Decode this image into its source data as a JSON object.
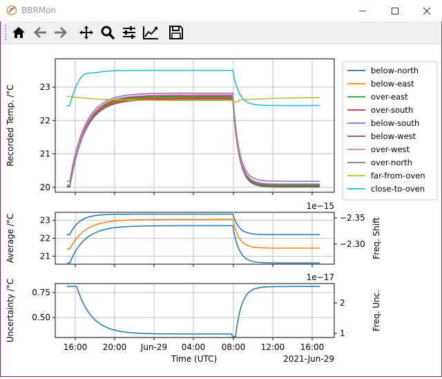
{
  "window": {
    "title": "BBRMon"
  },
  "toolbar": {
    "buttons": [
      "home-icon",
      "back-arrow-icon",
      "forward-arrow-icon",
      "pan-icon",
      "zoom-icon",
      "subplots-config-icon",
      "edit-axes-icon",
      "save-icon"
    ]
  },
  "colors": {
    "below-north": "#1f77b4",
    "below-east": "#ff7f0e",
    "over-east": "#2ca02c",
    "over-south": "#d62728",
    "below-south": "#9467bd",
    "below-west": "#8c564b",
    "over-west": "#e377c2",
    "over-north": "#7f7f7f",
    "far-from-oven": "#bcbd22",
    "close-to-oven": "#17becf"
  },
  "chart_data": [
    {
      "type": "line",
      "ylabel": "Recorded Temp. /°C",
      "ylim": [
        19.85,
        23.85
      ],
      "yticks": [
        "20",
        "21",
        "22",
        "23"
      ],
      "grid": true,
      "legend_position": "right",
      "legend": [
        "below-north",
        "below-east",
        "over-east",
        "over-south",
        "below-south",
        "below-west",
        "over-west",
        "over-north",
        "far-from-oven",
        "close-to-oven"
      ],
      "series": [
        {
          "name": "below-north",
          "profile": "low",
          "baseline": 20.05,
          "plateau": 22.7,
          "tail": 20.08
        },
        {
          "name": "below-east",
          "profile": "low",
          "baseline": 20.03,
          "plateau": 22.68,
          "tail": 20.05
        },
        {
          "name": "over-east",
          "profile": "low",
          "baseline": 20.04,
          "plateau": 22.72,
          "tail": 20.06
        },
        {
          "name": "over-south",
          "profile": "low",
          "baseline": 20.0,
          "plateau": 22.66,
          "tail": 20.02
        },
        {
          "name": "below-south",
          "profile": "low",
          "baseline": 20.18,
          "plateau": 22.82,
          "tail": 20.18
        },
        {
          "name": "below-west",
          "profile": "low",
          "baseline": 20.02,
          "plateau": 22.75,
          "tail": 20.03
        },
        {
          "name": "over-west",
          "profile": "low",
          "baseline": 20.07,
          "plateau": 22.77,
          "tail": 20.1
        },
        {
          "name": "over-north",
          "profile": "low",
          "baseline": 20.0,
          "plateau": 22.63,
          "tail": 20.0
        },
        {
          "name": "far-from-oven",
          "profile": "far",
          "baseline": 22.72,
          "plateau": 22.6,
          "tail": 22.7
        },
        {
          "name": "close-to-oven",
          "profile": "close",
          "baseline": 22.45,
          "plateau": 23.5,
          "tail": 22.45
        }
      ]
    },
    {
      "type": "line",
      "ylabel": "Average /°C",
      "ylim": [
        20.55,
        23.45
      ],
      "yticks": [
        "21",
        "22",
        "23"
      ],
      "right_ylabel": "Freq. Shift",
      "right_ticks": [
        "−2.35",
        "−2.30"
      ],
      "right_exponent": "1e−15",
      "grid": true,
      "series": [
        {
          "name": "",
          "color_key": "close-to-oven",
          "color": "#1f77b4",
          "baseline": 22.2,
          "plateau": 23.35,
          "tail": 22.2
        },
        {
          "name": "",
          "color_key": "below-east",
          "color": "#ff7f0e",
          "baseline": 21.4,
          "plateau": 23.05,
          "tail": 21.45
        },
        {
          "name": "",
          "color_key": "below-north",
          "color": "#1f77b4",
          "baseline": 20.62,
          "plateau": 22.7,
          "tail": 20.62
        }
      ]
    },
    {
      "type": "line",
      "ylabel": "Uncertainty /°C",
      "ylim": [
        0.3,
        0.84
      ],
      "yticks": [
        "0.50",
        "0.75"
      ],
      "right_ylabel": "Freq. Unc.",
      "right_ticks": [
        "1",
        "2"
      ],
      "right_exponent": "1e−17",
      "grid": true,
      "xlabel": "Time (UTC)",
      "xticks": [
        "16:00",
        "20:00",
        "Jun-29",
        "04:00",
        "08:00",
        "12:00",
        "16:00"
      ],
      "x_offset_label": "2021-Jun-29",
      "series": [
        {
          "name": "",
          "color": "#1f77b4",
          "baseline": 0.81,
          "plateau": 0.335,
          "tail": 0.81
        }
      ]
    }
  ]
}
